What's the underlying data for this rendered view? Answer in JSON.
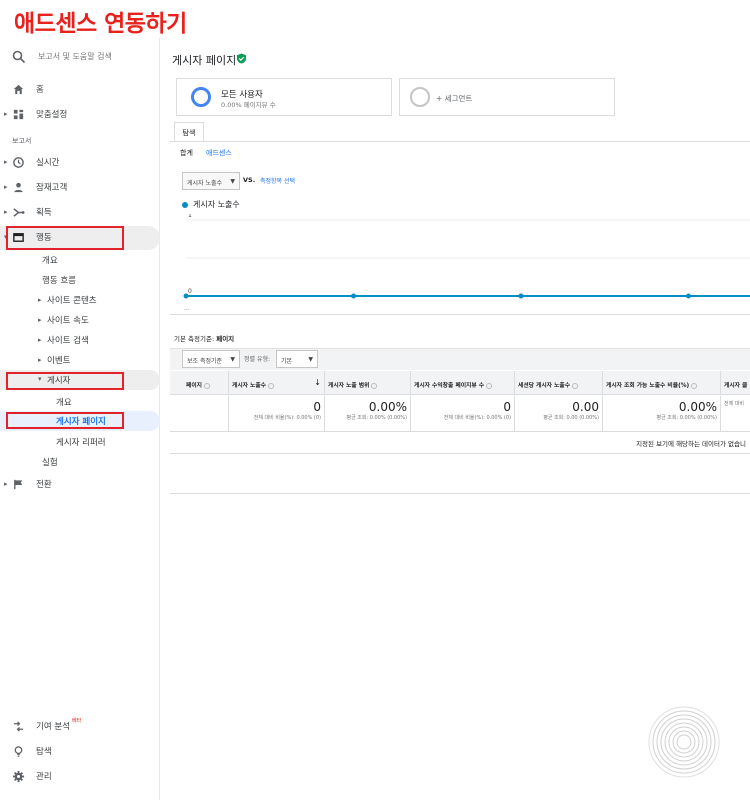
{
  "banner": {
    "title": "애드센스 연동하기"
  },
  "search": {
    "placeholder": "보고서 및 도움말 검색"
  },
  "sidebar": {
    "top_items": [
      {
        "label": "홈"
      },
      {
        "label": "맞춤설정"
      }
    ],
    "section_label": "보고서",
    "report_items": [
      {
        "label": "실시간"
      },
      {
        "label": "잠재고객"
      },
      {
        "label": "획득"
      },
      {
        "label": "행동"
      }
    ],
    "behavior_sub": [
      {
        "label": "개요"
      },
      {
        "label": "행동 흐름"
      },
      {
        "label": "사이트 콘텐츠"
      },
      {
        "label": "사이트 속도"
      },
      {
        "label": "사이트 검색"
      },
      {
        "label": "이벤트"
      },
      {
        "label": "게시자"
      }
    ],
    "publisher_sub": [
      {
        "label": "개요"
      },
      {
        "label": "게시자 페이지"
      },
      {
        "label": "게시자 리퍼러"
      }
    ],
    "experiments": "실험",
    "conversions": "전환",
    "bottom_items": [
      {
        "label": "기여 분석",
        "badge": "베타"
      },
      {
        "label": "탐색"
      },
      {
        "label": "관리"
      }
    ]
  },
  "main": {
    "page_title": "게시자 페이지",
    "segments": [
      {
        "name": "모든 사용자",
        "sub": "0.00% 페이지뷰 수"
      },
      {
        "add": "+ 세그먼트"
      }
    ],
    "tab": "탐색",
    "subtabs": [
      "합계",
      "애드센스"
    ],
    "metric_dropdown": "게시자 노출수",
    "vs": "VS.",
    "compare_link": "측정항목 선택",
    "legend": "게시자 노출수",
    "primary_dim_label": "기본 측정기준:",
    "primary_dim_value": "페이지",
    "secondary_dim": "보조 측정기준",
    "sort_label": "정렬 유형:",
    "sort_value": "기본",
    "table_headers": [
      "페이지",
      "게시자 노출수",
      "게시자 노출 범위",
      "게시자 수익창출 페이지뷰 수",
      "세션당 게시자 노출수",
      "게시자 조회 가능 노출수 비율(%)",
      "게시자 클"
    ],
    "table_values": [
      {
        "big": "0",
        "small": "전체 대비 비율(%): 0.00% (0)"
      },
      {
        "big": "0.00%",
        "small": "평균 조회: 0.00% (0.00%)"
      },
      {
        "big": "0",
        "small": "전체 대비 비율(%): 0.00% (0)"
      },
      {
        "big": "0.00",
        "small": "평균 조회: 0.00 (0.00%)"
      },
      {
        "big": "0.00%",
        "small": "평균 조회: 0.00% (0.00%)"
      },
      {
        "big": "",
        "small": "전체 대비"
      }
    ],
    "no_data": "지정된 보기에 해당하는 데이터가 없습니"
  },
  "chart_data": {
    "type": "line",
    "series": [
      {
        "name": "게시자 노출수",
        "values": [
          0,
          0,
          0,
          0,
          0
        ]
      }
    ],
    "ylim": [
      0,
      1
    ],
    "y_ticks": [
      "1",
      "0"
    ],
    "x_ticks": [
      "..."
    ]
  }
}
